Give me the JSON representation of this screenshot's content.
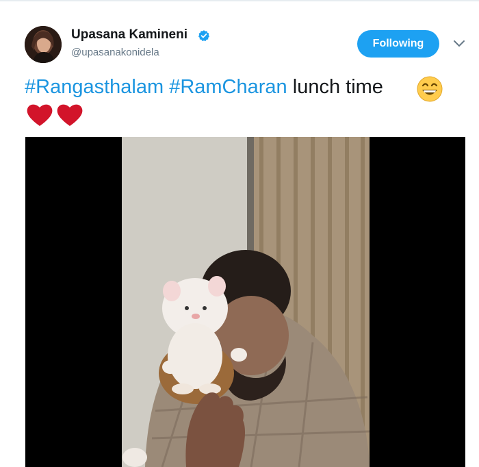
{
  "header": {
    "display_name": "Upasana Kamineni",
    "handle": "@upasanakonidela",
    "follow_label": "Following"
  },
  "tweet": {
    "hashtag1": "#Rangasthalam",
    "hashtag2": "#RamCharan",
    "text": "lunch time",
    "emoji": "grinning-face-with-smiling-eyes",
    "second_line_emoji": "red-heart x2"
  },
  "colors": {
    "accent": "#1da1f2",
    "link": "#1b95e0",
    "handle_grey": "#657786"
  }
}
